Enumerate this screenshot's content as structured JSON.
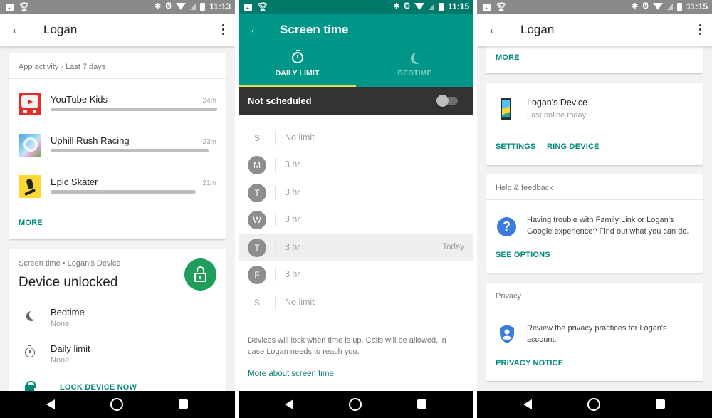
{
  "panels": {
    "left": {
      "status_time": "11:13",
      "title": "Logan",
      "app_activity": {
        "header": "App activity · Last 7 days",
        "apps": [
          {
            "name": "YouTube Kids",
            "time": "24m",
            "usage_fraction": 1.0
          },
          {
            "name": "Uphill Rush Racing",
            "time": "23m",
            "usage_fraction": 0.95
          },
          {
            "name": "Epic Skater",
            "time": "21m",
            "usage_fraction": 0.87
          }
        ],
        "more_label": "MORE"
      },
      "screen_time": {
        "subtitle": "Screen time • Logan's Device",
        "title": "Device unlocked",
        "rows": [
          {
            "label": "Bedtime",
            "value": "None",
            "icon": "moon-icon"
          },
          {
            "label": "Daily limit",
            "value": "None",
            "icon": "timer-icon"
          }
        ],
        "lock_now_label": "LOCK DEVICE NOW"
      }
    },
    "middle": {
      "status_time": "11:15",
      "title": "Screen time",
      "tabs": [
        {
          "label": "DAILY LIMIT",
          "icon": "timer-icon",
          "active": true
        },
        {
          "label": "BEDTIME",
          "icon": "moon-icon",
          "active": false
        }
      ],
      "schedule": {
        "label": "Not scheduled",
        "enabled": false
      },
      "days": [
        {
          "day": "S",
          "limit": "No limit",
          "badge": false,
          "today": false
        },
        {
          "day": "M",
          "limit": "3 hr",
          "badge": true,
          "today": false
        },
        {
          "day": "T",
          "limit": "3 hr",
          "badge": true,
          "today": false
        },
        {
          "day": "W",
          "limit": "3 hr",
          "badge": true,
          "today": false
        },
        {
          "day": "T",
          "limit": "3 hr",
          "badge": true,
          "today": true
        },
        {
          "day": "F",
          "limit": "3 hr",
          "badge": true,
          "today": false
        },
        {
          "day": "S",
          "limit": "No limit",
          "badge": false,
          "today": false
        }
      ],
      "today_label": "Today",
      "note": "Devices will lock when time is up. Calls will be allowed, in case Logan needs to reach you.",
      "more_link": "More about screen time"
    },
    "right": {
      "status_time": "11:15",
      "title": "Logan",
      "more_label": "MORE",
      "device": {
        "name": "Logan's Device",
        "status": "Last online today",
        "settings_label": "SETTINGS",
        "ring_label": "RING DEVICE"
      },
      "help": {
        "header": "Help & feedback",
        "text": "Having trouble with Family Link or Logan's Google experience? Find out what you can do.",
        "action": "SEE OPTIONS"
      },
      "privacy": {
        "header": "Privacy",
        "text": "Review the privacy practices for Logan's account.",
        "action": "PRIVACY NOTICE"
      }
    }
  },
  "colors": {
    "accent_teal": "#009688",
    "link_teal": "#00897b",
    "tab_indicator": "#d4e157",
    "unlock_green": "#1e9e5a",
    "help_blue": "#3b7bdc"
  }
}
